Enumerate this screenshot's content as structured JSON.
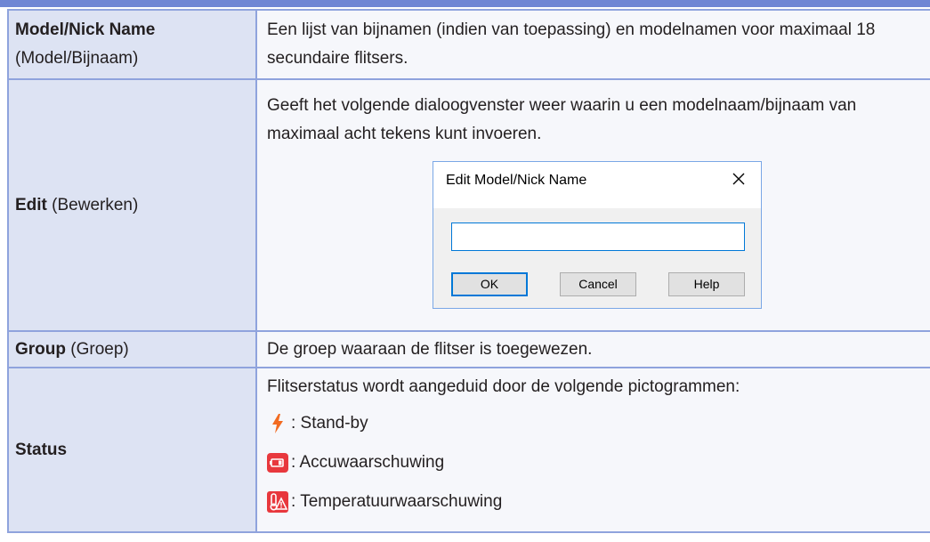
{
  "rows": {
    "model": {
      "label_bold": "Model/Nick Name",
      "label_sub": "(Model/Bijnaam)",
      "desc": "Een lijst van bijnamen (indien van toepassing) en modelnamen voor maximaal 18 secundaire flitsers."
    },
    "edit": {
      "label_bold": "Edit",
      "label_sub": "(Bewerken)",
      "desc": "Geeft het volgende dialoogvenster weer waarin u een modelnaam/bijnaam van maximaal acht tekens kunt invoeren."
    },
    "group": {
      "label_bold": "Group",
      "label_sub": "(Groep)",
      "desc": "De groep waaraan de flitser is toegewezen."
    },
    "status": {
      "label_bold": "Status",
      "intro": "Flitserstatus wordt aangeduid door de volgende pictogrammen:",
      "items": [
        {
          "icon": "flash-standby-icon",
          "text": ": Stand-by",
          "color": "#f26b21"
        },
        {
          "icon": "battery-warning-icon",
          "text": ": Accuwaarschuwing",
          "color": "#e8383d"
        },
        {
          "icon": "temperature-warning-icon",
          "text": ": Temperatuurwaarschuwing",
          "color": "#e8383d"
        }
      ]
    }
  },
  "dialog": {
    "title": "Edit Model/Nick Name",
    "input_value": "",
    "ok": "OK",
    "cancel": "Cancel",
    "help": "Help"
  },
  "colors": {
    "header_rule": "#6f86d4",
    "border": "#8fa3dd",
    "label_bg": "#dde3f3",
    "focus_blue": "#0078d7"
  }
}
